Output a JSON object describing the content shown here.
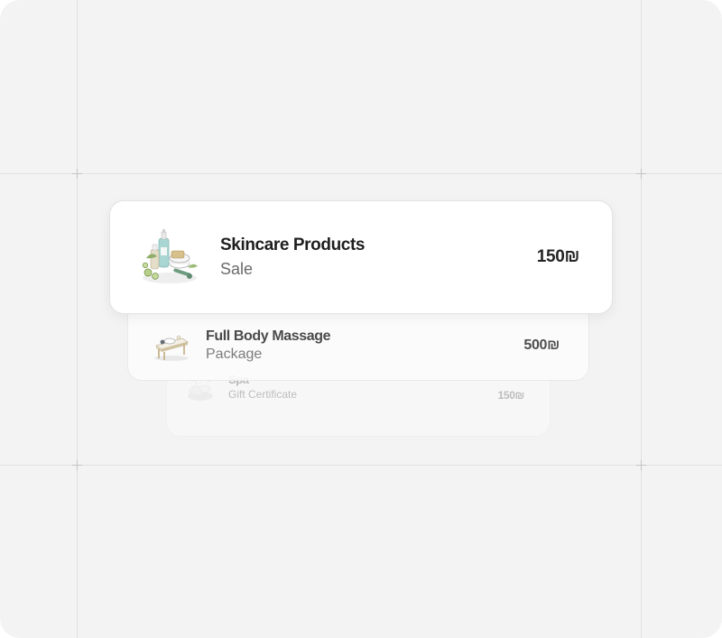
{
  "colors": {
    "background": "#f3f3f3",
    "card": "#ffffff",
    "guide_line": "#e1e1e1",
    "title_text": "#1f1f1f",
    "subtitle_text": "#6a6a6a"
  },
  "cards": [
    {
      "title": "Skincare Products",
      "subtitle": "Sale",
      "price": "150₪",
      "icon": "skincare-products-icon"
    },
    {
      "title": "Full Body Massage",
      "subtitle": "Package",
      "price": "500₪",
      "icon": "massage-table-icon"
    },
    {
      "title": "Spa",
      "subtitle": "Gift Certificate",
      "price": "150₪",
      "icon": "spa-stones-icon"
    }
  ]
}
